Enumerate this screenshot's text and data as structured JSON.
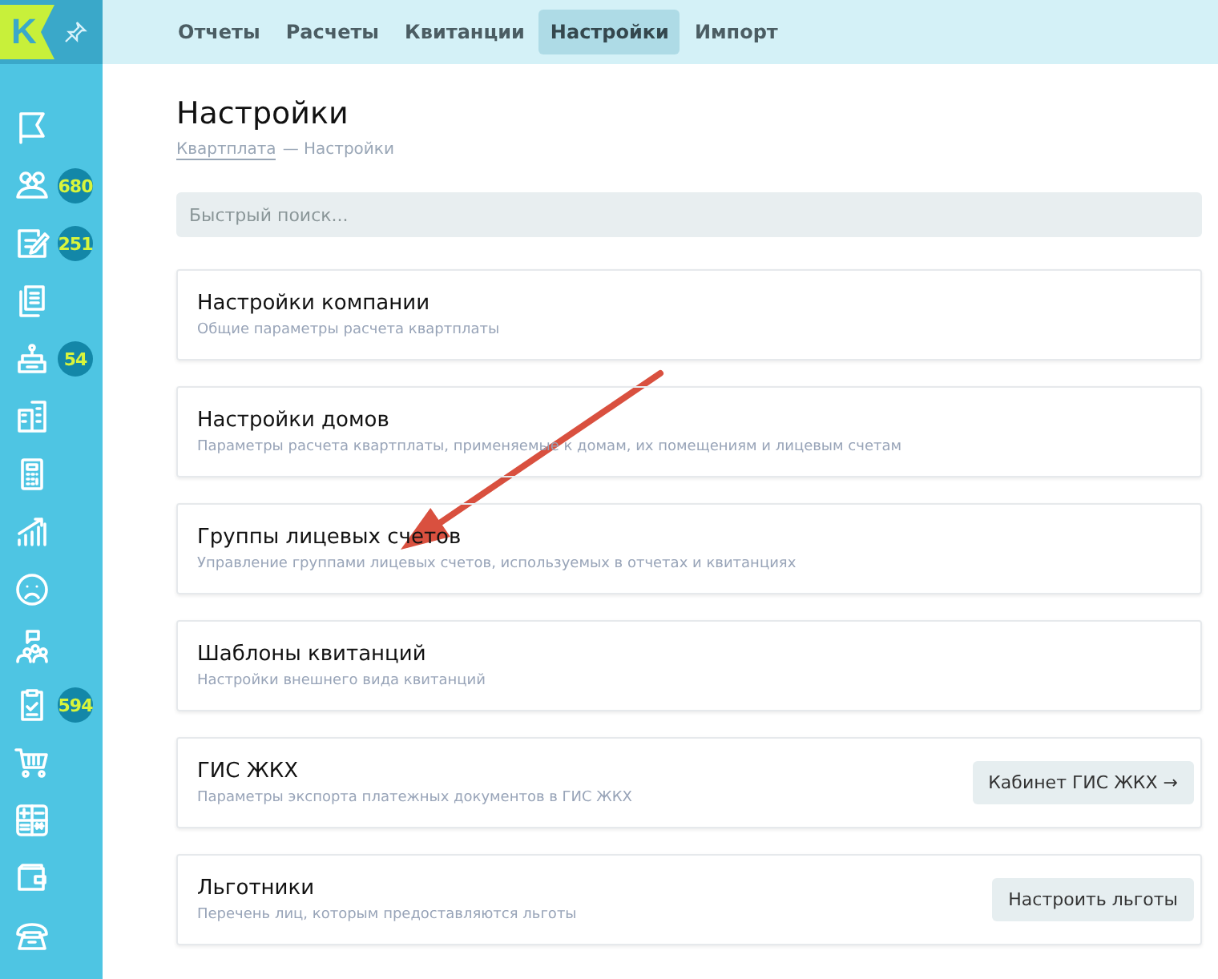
{
  "logo": {
    "letter": "K"
  },
  "sidebar": {
    "items": [
      {
        "kind": "flag"
      },
      {
        "kind": "people",
        "badge": "680"
      },
      {
        "kind": "edit",
        "badge": "251"
      },
      {
        "kind": "documents"
      },
      {
        "kind": "desk",
        "badge": "54"
      },
      {
        "kind": "building"
      },
      {
        "kind": "calculator"
      },
      {
        "kind": "chart"
      },
      {
        "kind": "face"
      },
      {
        "kind": "meeting"
      },
      {
        "kind": "clipboard",
        "badge": "594"
      },
      {
        "kind": "cart"
      },
      {
        "kind": "keypad"
      },
      {
        "kind": "wallet"
      },
      {
        "kind": "phone"
      }
    ]
  },
  "tabs": [
    {
      "label": "Отчеты",
      "selected": false
    },
    {
      "label": "Расчеты",
      "selected": false
    },
    {
      "label": "Квитанции",
      "selected": false
    },
    {
      "label": "Настройки",
      "selected": true
    },
    {
      "label": "Импорт",
      "selected": false
    }
  ],
  "page": {
    "title": "Настройки",
    "breadcrumb": {
      "link": "Квартплата",
      "current": "— Настройки"
    }
  },
  "search": {
    "placeholder": "Быстрый поиск..."
  },
  "cards": [
    {
      "title": "Настройки компании",
      "description": "Общие параметры расчета квартплаты"
    },
    {
      "title": "Настройки домов",
      "description": "Параметры расчета квартплаты, применяемые к домам, их помещениям и лицевым счетам"
    },
    {
      "title": "Группы лицевых счетов",
      "description": "Управление группами лицевых счетов, используемых в отчетах и квитанциях"
    },
    {
      "title": "Шаблоны квитанций",
      "description": "Настройки внешнего вида квитанций"
    },
    {
      "title": "ГИС ЖКХ",
      "description": "Параметры экспорта платежных документов в ГИС ЖКХ",
      "button": "Кабинет ГИС ЖКХ →"
    },
    {
      "title": "Льготники",
      "description": "Перечень лиц, которым предоставляются льготы",
      "button": "Настроить льготы"
    }
  ]
}
